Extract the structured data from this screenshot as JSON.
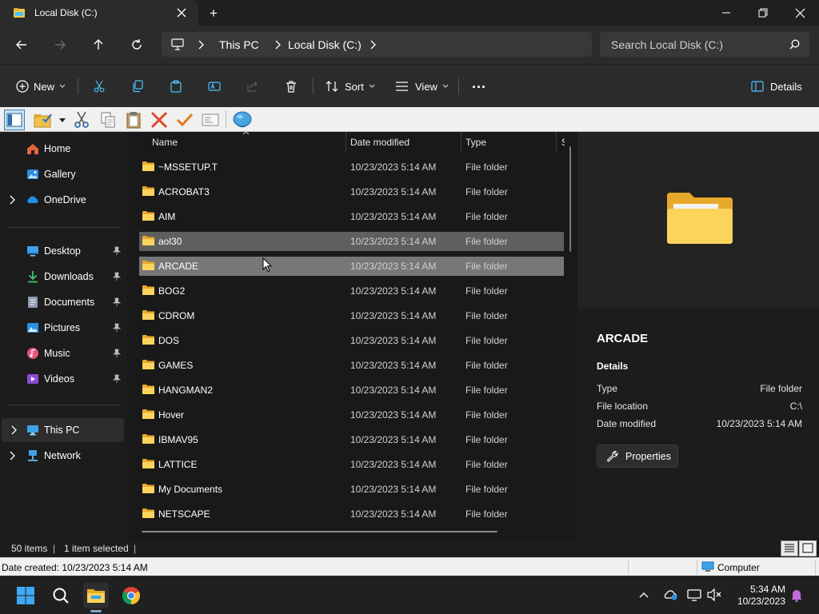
{
  "window": {
    "tab_title": "Local Disk (C:)",
    "new_tab": "+",
    "app_icon": "file-explorer-icon"
  },
  "address": {
    "crumbs": [
      "This PC",
      "Local Disk (C:)"
    ],
    "search_placeholder": "Search Local Disk (C:)"
  },
  "commands": {
    "new_label": "New",
    "sort_label": "Sort",
    "view_label": "View",
    "more_label": "...",
    "details_label": "Details"
  },
  "nav": {
    "items": [
      {
        "label": "Home",
        "icon": "home-icon"
      },
      {
        "label": "Gallery",
        "icon": "gallery-icon"
      },
      {
        "label": "OneDrive",
        "icon": "onedrive-icon"
      },
      {
        "label": "Desktop",
        "icon": "desktop-icon"
      },
      {
        "label": "Downloads",
        "icon": "downloads-icon"
      },
      {
        "label": "Documents",
        "icon": "documents-icon"
      },
      {
        "label": "Pictures",
        "icon": "pictures-icon"
      },
      {
        "label": "Music",
        "icon": "music-icon"
      },
      {
        "label": "Videos",
        "icon": "videos-icon"
      },
      {
        "label": "This PC",
        "icon": "this-pc-icon"
      },
      {
        "label": "Network",
        "icon": "network-icon"
      }
    ]
  },
  "columns": {
    "name": "Name",
    "date": "Date modified",
    "type": "Type",
    "size": "S"
  },
  "files": [
    {
      "name": "~MSSETUP.T",
      "date": "10/23/2023 5:14 AM",
      "type": "File folder"
    },
    {
      "name": "ACROBAT3",
      "date": "10/23/2023 5:14 AM",
      "type": "File folder"
    },
    {
      "name": "AIM",
      "date": "10/23/2023 5:14 AM",
      "type": "File folder"
    },
    {
      "name": "aol30",
      "date": "10/23/2023 5:14 AM",
      "type": "File folder"
    },
    {
      "name": "ARCADE",
      "date": "10/23/2023 5:14 AM",
      "type": "File folder"
    },
    {
      "name": "BOG2",
      "date": "10/23/2023 5:14 AM",
      "type": "File folder"
    },
    {
      "name": "CDROM",
      "date": "10/23/2023 5:14 AM",
      "type": "File folder"
    },
    {
      "name": "DOS",
      "date": "10/23/2023 5:14 AM",
      "type": "File folder"
    },
    {
      "name": "GAMES",
      "date": "10/23/2023 5:14 AM",
      "type": "File folder"
    },
    {
      "name": "HANGMAN2",
      "date": "10/23/2023 5:14 AM",
      "type": "File folder"
    },
    {
      "name": "Hover",
      "date": "10/23/2023 5:14 AM",
      "type": "File folder"
    },
    {
      "name": "IBMAV95",
      "date": "10/23/2023 5:14 AM",
      "type": "File folder"
    },
    {
      "name": "LATTICE",
      "date": "10/23/2023 5:14 AM",
      "type": "File folder"
    },
    {
      "name": "My Documents",
      "date": "10/23/2023 5:14 AM",
      "type": "File folder"
    },
    {
      "name": "NETSCAPE",
      "date": "10/23/2023 5:14 AM",
      "type": "File folder"
    }
  ],
  "details": {
    "title": "ARCADE",
    "section": "Details",
    "type_label": "Type",
    "type_value": "File folder",
    "location_label": "File location",
    "location_value": "C:\\",
    "date_label": "Date modified",
    "date_value": "10/23/2023 5:14 AM",
    "properties_label": "Properties"
  },
  "status": {
    "item_count": "50 items",
    "separator": "|",
    "selected": "1 item selected",
    "date_created": "Date created: 10/23/2023 5:14 AM",
    "zone": "Computer"
  },
  "taskbar": {
    "time": "5:34 AM",
    "date": "10/23/2023"
  },
  "colors": {
    "accent": "#4cc2ff",
    "folder": "#f4c542",
    "selection": "#777777"
  }
}
